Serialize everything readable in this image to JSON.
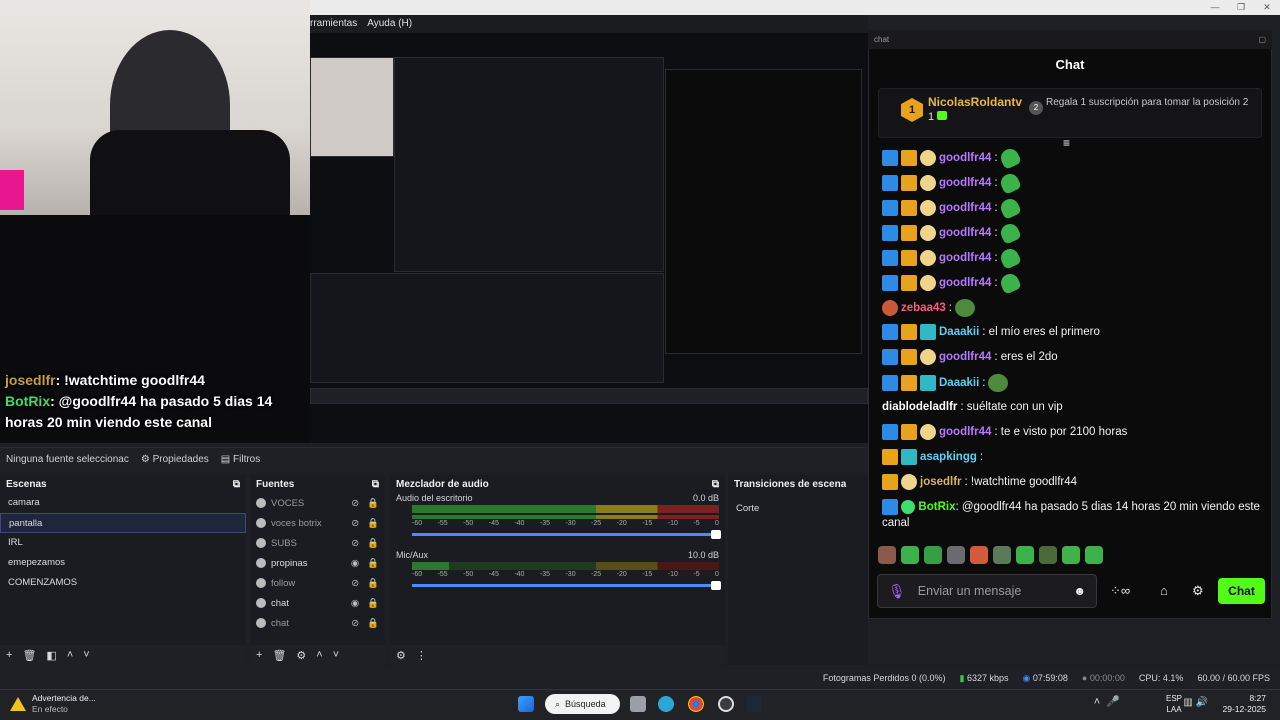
{
  "titlebar": {
    "controls": [
      "—",
      "❐",
      "✕"
    ]
  },
  "menubar": {
    "items": [
      "rramientas",
      "Ayuda (H)"
    ]
  },
  "overlay": {
    "line1": {
      "user": "josedlfr",
      "text": ": !watchtime goodlfr44"
    },
    "line2": {
      "user": "BotRix",
      "text": ": @goodlfr44 ha pasado 5 dias 14 horas 20 min viendo este canal"
    }
  },
  "obs": {
    "props_bar": {
      "no_source": "Ninguna fuente seleccionac",
      "properties": "Propiedades",
      "filters": "Filtros"
    },
    "scenes": {
      "title": "Escenas",
      "items": [
        "camara",
        "pantalla",
        "IRL",
        "emepezamos",
        "COMENZAMOS"
      ],
      "selected": 1
    },
    "sources": {
      "title": "Fuentes",
      "items": [
        "VOCES",
        "voces botrix",
        "SUBS",
        "propinas",
        "follow",
        "chat",
        "chat"
      ]
    },
    "mixer": {
      "title": "Mezclador de audio",
      "channels": [
        {
          "name": "Audio del escritorio",
          "db": "0.0 dB"
        },
        {
          "name": "Mic/Aux",
          "db": "10.0 dB"
        }
      ],
      "ticks": [
        "-60",
        "-55",
        "-50",
        "-45",
        "-40",
        "-35",
        "-30",
        "-25",
        "-20",
        "-15",
        "-10",
        "-5",
        "0"
      ]
    },
    "transitions": {
      "title": "Transiciones de escena",
      "value": "Corte"
    },
    "status": {
      "dropped": "Fotogramas Perdidos 0 (0.0%)",
      "bitrate": "6327 kbps",
      "live": "07:59:08",
      "rec": "00:00:00",
      "cpu": "CPU: 4.1%",
      "fps": "60.00 / 60.00 FPS"
    }
  },
  "taskbar": {
    "warning_title": "Advertencia de...",
    "warning_sub": "En efecto",
    "search": "Búsqueda",
    "lang1": "ESP",
    "lang2": "LAA",
    "time": "8:27",
    "date": "29-12-2025"
  },
  "chat": {
    "url": "chat",
    "title": "Chat",
    "gift": {
      "top_user": "NicolasRoldantv",
      "top_rank": "1",
      "top_count": "1",
      "rank2": "2",
      "rank2_text": "Regala 1 suscripción para tomar la posición 2"
    },
    "messages": [
      {
        "user": "goodlfr44",
        "text": ":"
      },
      {
        "user": "goodlfr44",
        "text": ":"
      },
      {
        "user": "goodlfr44",
        "text": ":"
      },
      {
        "user": "goodlfr44",
        "text": ":"
      },
      {
        "user": "goodlfr44",
        "text": ":"
      },
      {
        "user": "goodlfr44",
        "text": ":"
      },
      {
        "user": "zebaa43",
        "text": ":"
      },
      {
        "user": "Daaakii",
        "text": ": el mío eres el primero"
      },
      {
        "user": "goodlfr44",
        "text": ": eres el 2do"
      },
      {
        "user": "Daaakii",
        "text": ":"
      },
      {
        "user": "diablodeladlfr",
        "text": ": suéltate con un vip"
      },
      {
        "user": "goodlfr44",
        "text": ": te e visto por 2100 horas"
      },
      {
        "user": "asapkingg",
        "text": ":"
      },
      {
        "user": "josedlfr",
        "text": ": !watchtime goodlfr44"
      },
      {
        "user": "BotRix",
        "text": ": @goodlfr44 ha pasado 5 dias 14 horas 20 min viendo este canal"
      }
    ],
    "input_placeholder": "Enviar un mensaje",
    "send_label": "Chat"
  }
}
